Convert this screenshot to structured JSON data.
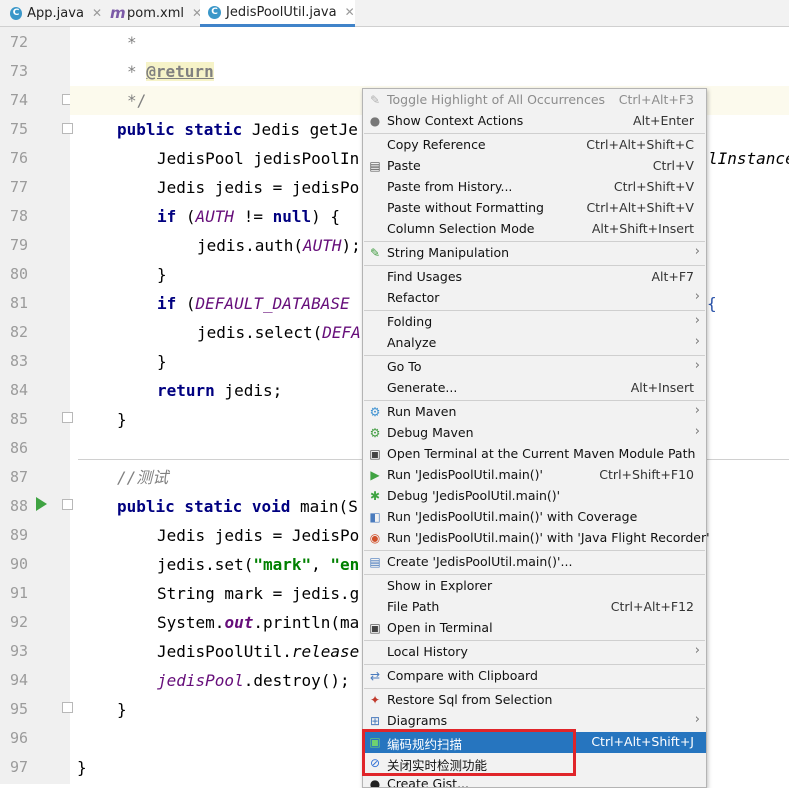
{
  "tabs": [
    {
      "label": "App.java",
      "icon": "java-class-icon"
    },
    {
      "label": "pom.xml",
      "icon": "maven-icon"
    },
    {
      "label": "JedisPoolUtil.java",
      "icon": "java-class-icon",
      "active": true
    }
  ],
  "line_numbers": [
    "72",
    "73",
    "74",
    "75",
    "76",
    "77",
    "78",
    "79",
    "80",
    "81",
    "82",
    "83",
    "84",
    "85",
    "86",
    "87",
    "88",
    "89",
    "90",
    "91",
    "92",
    "93",
    "94",
    "95",
    "96",
    "97"
  ],
  "code": {
    "l72": "*",
    "l73_star": "* ",
    "l73_tag": "@return",
    "l74": "*/",
    "l75_kw": "public static",
    "l75_rest": " Jedis getJe",
    "l76": "JedisPool jedisPoolIn",
    "l76_right": "lInstance",
    "l77": "Jedis jedis = jedisPo",
    "l78_kw": "if",
    "l78_open": " (",
    "l78_const": "AUTH",
    "l78_op": " != ",
    "l78_null": "null",
    "l78_close": ") {",
    "l79_a": "jedis.auth(",
    "l79_const": "AUTH",
    "l79_b": ");",
    "l80": "}",
    "l81_kw": "if",
    "l81_open": " (",
    "l81_const": "DEFAULT_DATABASE",
    "l81_right": "{",
    "l82_a": "jedis.select(",
    "l82_const": "DEFA",
    "l83": "}",
    "l84_kw": "return",
    "l84_rest": " jedis;",
    "l85": "}",
    "l87": "//测试",
    "l88_kw": "public static void",
    "l88_rest": " main(S",
    "l89": "Jedis jedis = JedisPo",
    "l90_a": "jedis.set(",
    "l90_s1": "\"mark\"",
    "l90_b": ", ",
    "l90_s2": "\"en",
    "l91": "String mark = jedis.g",
    "l92_a": "System.",
    "l92_out": "out",
    "l92_b": ".println(ma",
    "l93_a": "JedisPoolUtil.",
    "l93_m": "release",
    "l94_f": "jedisPool",
    "l94_b": ".destroy();",
    "l95": "}",
    "l97": "}"
  },
  "menu": {
    "items": [
      {
        "label": "Toggle Highlight of All Occurrences",
        "shortcut": "Ctrl+Alt+F3",
        "disabled": true
      },
      {
        "label": "Show Context Actions",
        "shortcut": "Alt+Enter",
        "icon": "lightbulb-icon"
      },
      {
        "label": "Copy Reference",
        "shortcut": "Ctrl+Alt+Shift+C"
      },
      {
        "label": "Paste",
        "shortcut": "Ctrl+V",
        "icon": "clipboard-icon"
      },
      {
        "label": "Paste from History...",
        "shortcut": "Ctrl+Shift+V"
      },
      {
        "label": "Paste without Formatting",
        "shortcut": "Ctrl+Alt+Shift+V"
      },
      {
        "label": "Column Selection Mode",
        "shortcut": "Alt+Shift+Insert"
      },
      {
        "label": "String Manipulation",
        "submenu": true,
        "icon": "pencil-icon"
      },
      {
        "label": "Find Usages",
        "shortcut": "Alt+F7"
      },
      {
        "label": "Refactor",
        "submenu": true
      },
      {
        "label": "Folding",
        "submenu": true
      },
      {
        "label": "Analyze",
        "submenu": true
      },
      {
        "label": "Go To",
        "submenu": true
      },
      {
        "label": "Generate...",
        "shortcut": "Alt+Insert"
      },
      {
        "label": "Run Maven",
        "submenu": true,
        "icon": "gear-icon"
      },
      {
        "label": "Debug Maven",
        "submenu": true,
        "icon": "gear-icon"
      },
      {
        "label": "Open Terminal at the Current Maven Module Path",
        "icon": "terminal-icon"
      },
      {
        "label": "Run 'JedisPoolUtil.main()'",
        "shortcut": "Ctrl+Shift+F10",
        "icon": "run-icon"
      },
      {
        "label": "Debug 'JedisPoolUtil.main()'",
        "icon": "debug-icon"
      },
      {
        "label": "Run 'JedisPoolUtil.main()' with Coverage",
        "icon": "coverage-icon"
      },
      {
        "label": "Run 'JedisPoolUtil.main()' with 'Java Flight Recorder'",
        "icon": "flight-recorder-icon"
      },
      {
        "label": "Create 'JedisPoolUtil.main()'...",
        "icon": "create-config-icon"
      },
      {
        "label": "Show in Explorer"
      },
      {
        "label": "File Path",
        "shortcut": "Ctrl+Alt+F12"
      },
      {
        "label": "Open in Terminal",
        "icon": "terminal-icon"
      },
      {
        "label": "Local History",
        "submenu": true
      },
      {
        "label": "Compare with Clipboard",
        "icon": "compare-icon"
      },
      {
        "label": "Restore Sql from Selection",
        "icon": "sql-icon"
      },
      {
        "label": "Diagrams",
        "submenu": true,
        "icon": "diagram-icon"
      },
      {
        "label": "编码规约扫描",
        "shortcut": "Ctrl+Alt+Shift+J",
        "selected": true,
        "icon": "scan-icon"
      },
      {
        "label": "关闭实时检测功能",
        "icon": "disable-icon"
      },
      {
        "label": "Create Gist...",
        "icon": "github-icon"
      }
    ]
  },
  "colors": {
    "selection": "#2675bf",
    "highlight_box": "#e0252a",
    "keyword": "#000080",
    "constant": "#660e7a",
    "string": "#008000"
  }
}
